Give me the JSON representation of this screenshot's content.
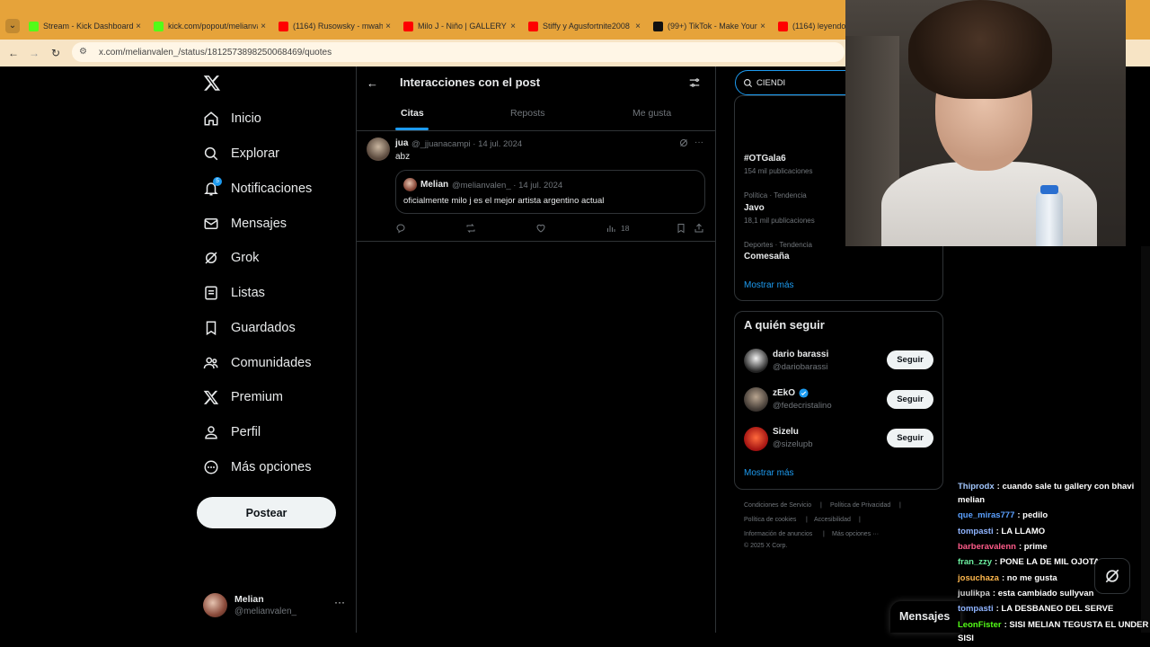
{
  "browser": {
    "tabs": [
      {
        "title": "Stream - Kick Dashboard",
        "color": "#53fc18"
      },
      {
        "title": "kick.com/popout/melianvalen",
        "color": "#53fc18"
      },
      {
        "title": "(1164) Rusowsky - mwah",
        "color": "#ff0000"
      },
      {
        "title": "Milo J - Niño | GALLERY S",
        "color": "#ff0000"
      },
      {
        "title": "Stiffy y Agusfortnite2008",
        "color": "#ff0000"
      },
      {
        "title": "(99+) TikTok - Make Your",
        "color": "#111111"
      },
      {
        "title": "(1164) leyendo m",
        "color": "#ff0000"
      }
    ],
    "url": "x.com/melianvalen_/status/1812573898250068469/quotes"
  },
  "nav": {
    "items": [
      {
        "label": "Inicio",
        "icon": "home-icon"
      },
      {
        "label": "Explorar",
        "icon": "search-icon"
      },
      {
        "label": "Notificaciones",
        "icon": "bell-icon",
        "badge": "5"
      },
      {
        "label": "Mensajes",
        "icon": "mail-icon"
      },
      {
        "label": "Grok",
        "icon": "grok-icon"
      },
      {
        "label": "Listas",
        "icon": "list-icon"
      },
      {
        "label": "Guardados",
        "icon": "bookmark-icon"
      },
      {
        "label": "Comunidades",
        "icon": "people-icon"
      },
      {
        "label": "Premium",
        "icon": "x-icon"
      },
      {
        "label": "Perfil",
        "icon": "person-icon"
      },
      {
        "label": "Más opciones",
        "icon": "more-circle-icon"
      }
    ],
    "post_label": "Postear",
    "account": {
      "name": "Melian",
      "handle": "@melianvalen_",
      "more": "···"
    }
  },
  "main": {
    "title": "Interacciones con el post",
    "tabs": [
      "Citas",
      "Reposts",
      "Me gusta"
    ],
    "tweet": {
      "name": "jua",
      "handle_date": "@_jjuanacampi · 14 jul. 2024",
      "text": "abz",
      "quote": {
        "name": "Melian",
        "handle_date": "@melianvalen_ · 14 jul. 2024",
        "text": "oficialmente milo j es el mejor artista argentino actual"
      },
      "views": "18",
      "more": "···"
    }
  },
  "right": {
    "search_value": "CIENDI",
    "trends": [
      {
        "meta": "",
        "topic": "#OTGala6",
        "count": "154 mil publicaciones"
      },
      {
        "meta": "Política · Tendencia",
        "topic": "Javo",
        "count": "18,1 mil publicaciones"
      },
      {
        "meta": "Deportes · Tendencia",
        "topic": "Comesaña",
        "count": ""
      }
    ],
    "show_more": "Mostrar más",
    "who_to_follow": {
      "title": "A quién seguir",
      "users": [
        {
          "name": "dario barassi",
          "handle": "@dariobarassi",
          "verified": false
        },
        {
          "name": "zEkO",
          "handle": "@fedecristalino",
          "verified": true
        },
        {
          "name": "Sizelu",
          "handle": "@sizelupb",
          "verified": false
        }
      ],
      "follow_label": "Seguir",
      "show_more": "Mostrar más"
    },
    "footer": [
      "Condiciones de Servicio",
      "|",
      "Política de Privacidad",
      "|",
      "Política de cookies",
      "|",
      "Accesibilidad",
      "|",
      "Información de anuncios",
      "|",
      "Más opciones ···",
      "© 2025 X Corp."
    ]
  },
  "overlay": {
    "messages_label": "Mensajes",
    "chat": [
      {
        "user": "Thiprodx",
        "color": "#a3c8ff",
        "text": ": cuando sale tu gallery con bhavi"
      },
      {
        "user": "",
        "color": "#ffffff",
        "text": "melian"
      },
      {
        "user": "que_miras777",
        "color": "#5aa0ff",
        "text": ": pedilo"
      },
      {
        "user": "tompasti",
        "color": "#8fb4ff",
        "text": ": LA LLAMO"
      },
      {
        "user": "barberavalenn",
        "color": "#ff5c8a",
        "text": ": prime"
      },
      {
        "user": "fran_zzy",
        "color": "#6cf0a0",
        "text": ": PONE LA DE MIL OJOTAS"
      },
      {
        "user": "josuchaza",
        "color": "#ffb84d",
        "text": ": no me gusta"
      },
      {
        "user": "juulikpa",
        "color": "#d0d0d0",
        "text": ": esta cambiado sullyvan"
      },
      {
        "user": "tompasti",
        "color": "#8fb4ff",
        "text": ": LA DESBANEO DEL SERVE"
      },
      {
        "user": "LeonFister",
        "color": "#53fc18",
        "text": ": SISI MELIAN TEGUSTA EL UNDER"
      },
      {
        "user": "",
        "color": "#ffffff",
        "text": "SISI"
      }
    ]
  },
  "colors": {
    "accent": "#1d9bf0",
    "bg": "#000000",
    "border": "#2f3336",
    "muted": "#71767b",
    "tabbar": "#e6a33a"
  }
}
